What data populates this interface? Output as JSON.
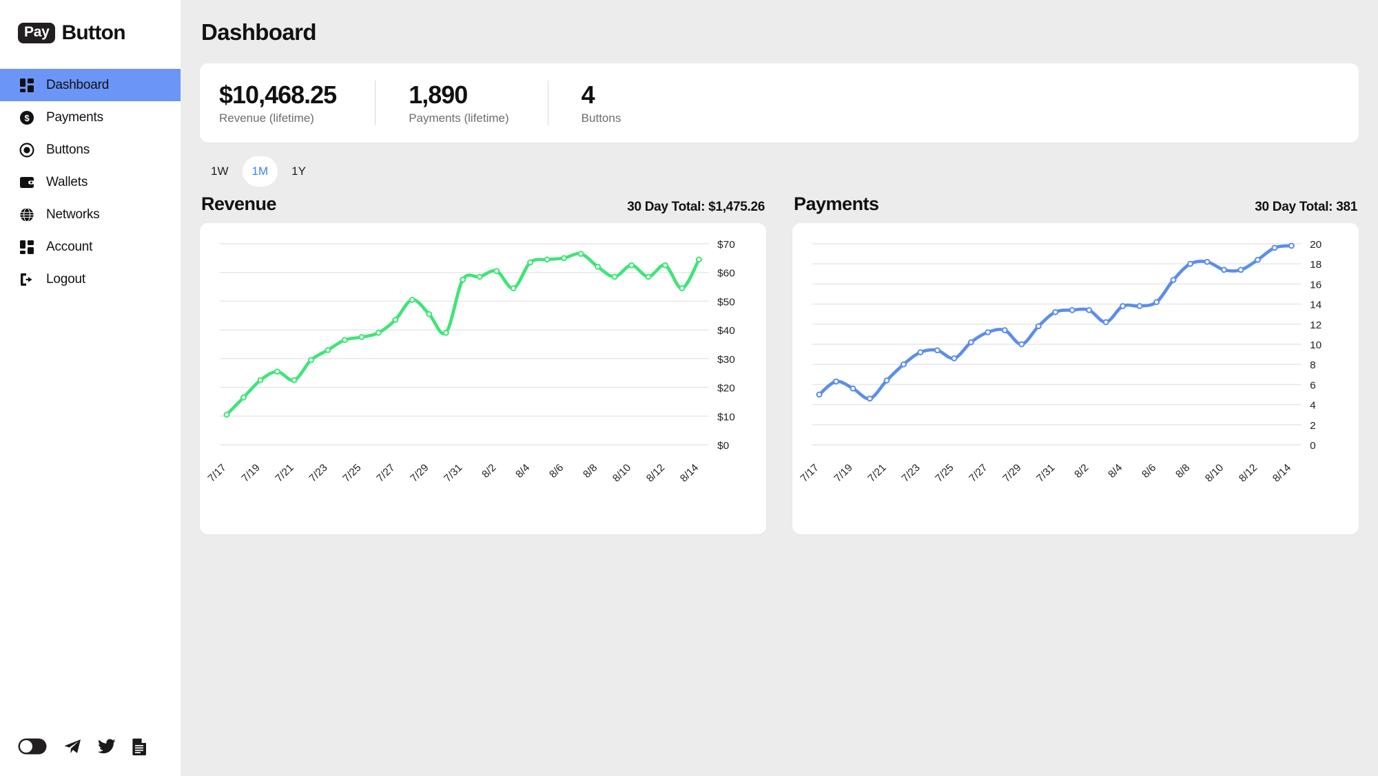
{
  "brand": {
    "chip": "Pay",
    "word": "Button"
  },
  "sidebar": {
    "items": [
      {
        "label": "Dashboard",
        "icon": "grid-icon",
        "active": true
      },
      {
        "label": "Payments",
        "icon": "dollar-circle-icon",
        "active": false
      },
      {
        "label": "Buttons",
        "icon": "radio-dot-icon",
        "active": false
      },
      {
        "label": "Wallets",
        "icon": "wallet-icon",
        "active": false
      },
      {
        "label": "Networks",
        "icon": "globe-icon",
        "active": false
      },
      {
        "label": "Account",
        "icon": "grid-icon",
        "active": false
      },
      {
        "label": "Logout",
        "icon": "logout-icon",
        "active": false
      }
    ],
    "social": [
      {
        "name": "dark-mode-toggle-icon"
      },
      {
        "name": "telegram-icon"
      },
      {
        "name": "twitter-icon"
      },
      {
        "name": "docs-icon"
      }
    ]
  },
  "header": {
    "title": "Dashboard"
  },
  "stats": [
    {
      "value": "$10,468.25",
      "label": "Revenue (lifetime)"
    },
    {
      "value": "1,890",
      "label": "Payments (lifetime)"
    },
    {
      "value": "4",
      "label": "Buttons"
    }
  ],
  "range": {
    "options": [
      {
        "label": "1W",
        "active": false
      },
      {
        "label": "1M",
        "active": true
      },
      {
        "label": "1Y",
        "active": false
      }
    ]
  },
  "colors": {
    "accent_blue": "#6b95f7",
    "active_text_blue": "#3b82f6",
    "revenue_green": "#3ee577",
    "payments_blue": "#5b8def",
    "grid": "#e6e6e6"
  },
  "chart_data": [
    {
      "type": "line",
      "id": "revenue-chart",
      "title": "Revenue",
      "total_label": "30 Day Total: $1,475.26",
      "xlabel": "",
      "ylabel": "",
      "ylim": [
        0,
        70
      ],
      "yticks": [
        0,
        10,
        20,
        30,
        40,
        50,
        60,
        70
      ],
      "ytick_labels": [
        "$0",
        "$10",
        "$20",
        "$30",
        "$40",
        "$50",
        "$60",
        "$70"
      ],
      "grid": true,
      "legend": "none",
      "line_color": "#3ee577",
      "x": [
        "7/17",
        "7/18",
        "7/19",
        "7/20",
        "7/21",
        "7/22",
        "7/23",
        "7/24",
        "7/25",
        "7/26",
        "7/27",
        "7/28",
        "7/29",
        "7/30",
        "7/31",
        "8/1",
        "8/2",
        "8/3",
        "8/4",
        "8/5",
        "8/6",
        "8/7",
        "8/8",
        "8/9",
        "8/10",
        "8/11",
        "8/12",
        "8/13",
        "8/14"
      ],
      "xtick_labels": [
        "7/17",
        "7/19",
        "7/21",
        "7/23",
        "7/25",
        "7/27",
        "7/29",
        "7/31",
        "8/2",
        "8/4",
        "8/6",
        "8/8",
        "8/10",
        "8/12",
        "8/14"
      ],
      "values": [
        10.5,
        16.5,
        22.5,
        25.5,
        22.5,
        29.5,
        33,
        36.5,
        37.5,
        39,
        43.5,
        50.5,
        45.5,
        39,
        57.5,
        58.5,
        60.5,
        54.5,
        63.5,
        64.5,
        65,
        66.5,
        62,
        58.5,
        62.5,
        58.5,
        62.5,
        54.5,
        64.5
      ]
    },
    {
      "type": "line",
      "id": "payments-chart",
      "title": "Payments",
      "total_label": "30 Day Total: 381",
      "xlabel": "",
      "ylabel": "",
      "ylim": [
        0,
        20
      ],
      "yticks": [
        0,
        2,
        4,
        6,
        8,
        10,
        12,
        14,
        16,
        18,
        20
      ],
      "ytick_labels": [
        "0",
        "2",
        "4",
        "6",
        "8",
        "10",
        "12",
        "14",
        "16",
        "18",
        "20"
      ],
      "grid": true,
      "legend": "none",
      "line_color": "#5b8def",
      "x": [
        "7/17",
        "7/18",
        "7/19",
        "7/20",
        "7/21",
        "7/22",
        "7/23",
        "7/24",
        "7/25",
        "7/26",
        "7/27",
        "7/28",
        "7/29",
        "7/30",
        "7/31",
        "8/1",
        "8/2",
        "8/3",
        "8/4",
        "8/5",
        "8/6",
        "8/7",
        "8/8",
        "8/9",
        "8/10",
        "8/11",
        "8/12",
        "8/13",
        "8/14"
      ],
      "xtick_labels": [
        "7/17",
        "7/19",
        "7/21",
        "7/23",
        "7/25",
        "7/27",
        "7/29",
        "7/31",
        "8/2",
        "8/4",
        "8/6",
        "8/8",
        "8/10",
        "8/12",
        "8/14"
      ],
      "values": [
        5,
        6.3,
        5.6,
        4.6,
        6.4,
        8,
        9.2,
        9.4,
        8.6,
        10.2,
        11.2,
        11.4,
        10,
        11.8,
        13.2,
        13.4,
        13.4,
        12.2,
        13.8,
        13.8,
        14.2,
        16.4,
        18,
        18.2,
        17.4,
        17.4,
        18.4,
        19.6,
        19.8
      ]
    }
  ]
}
